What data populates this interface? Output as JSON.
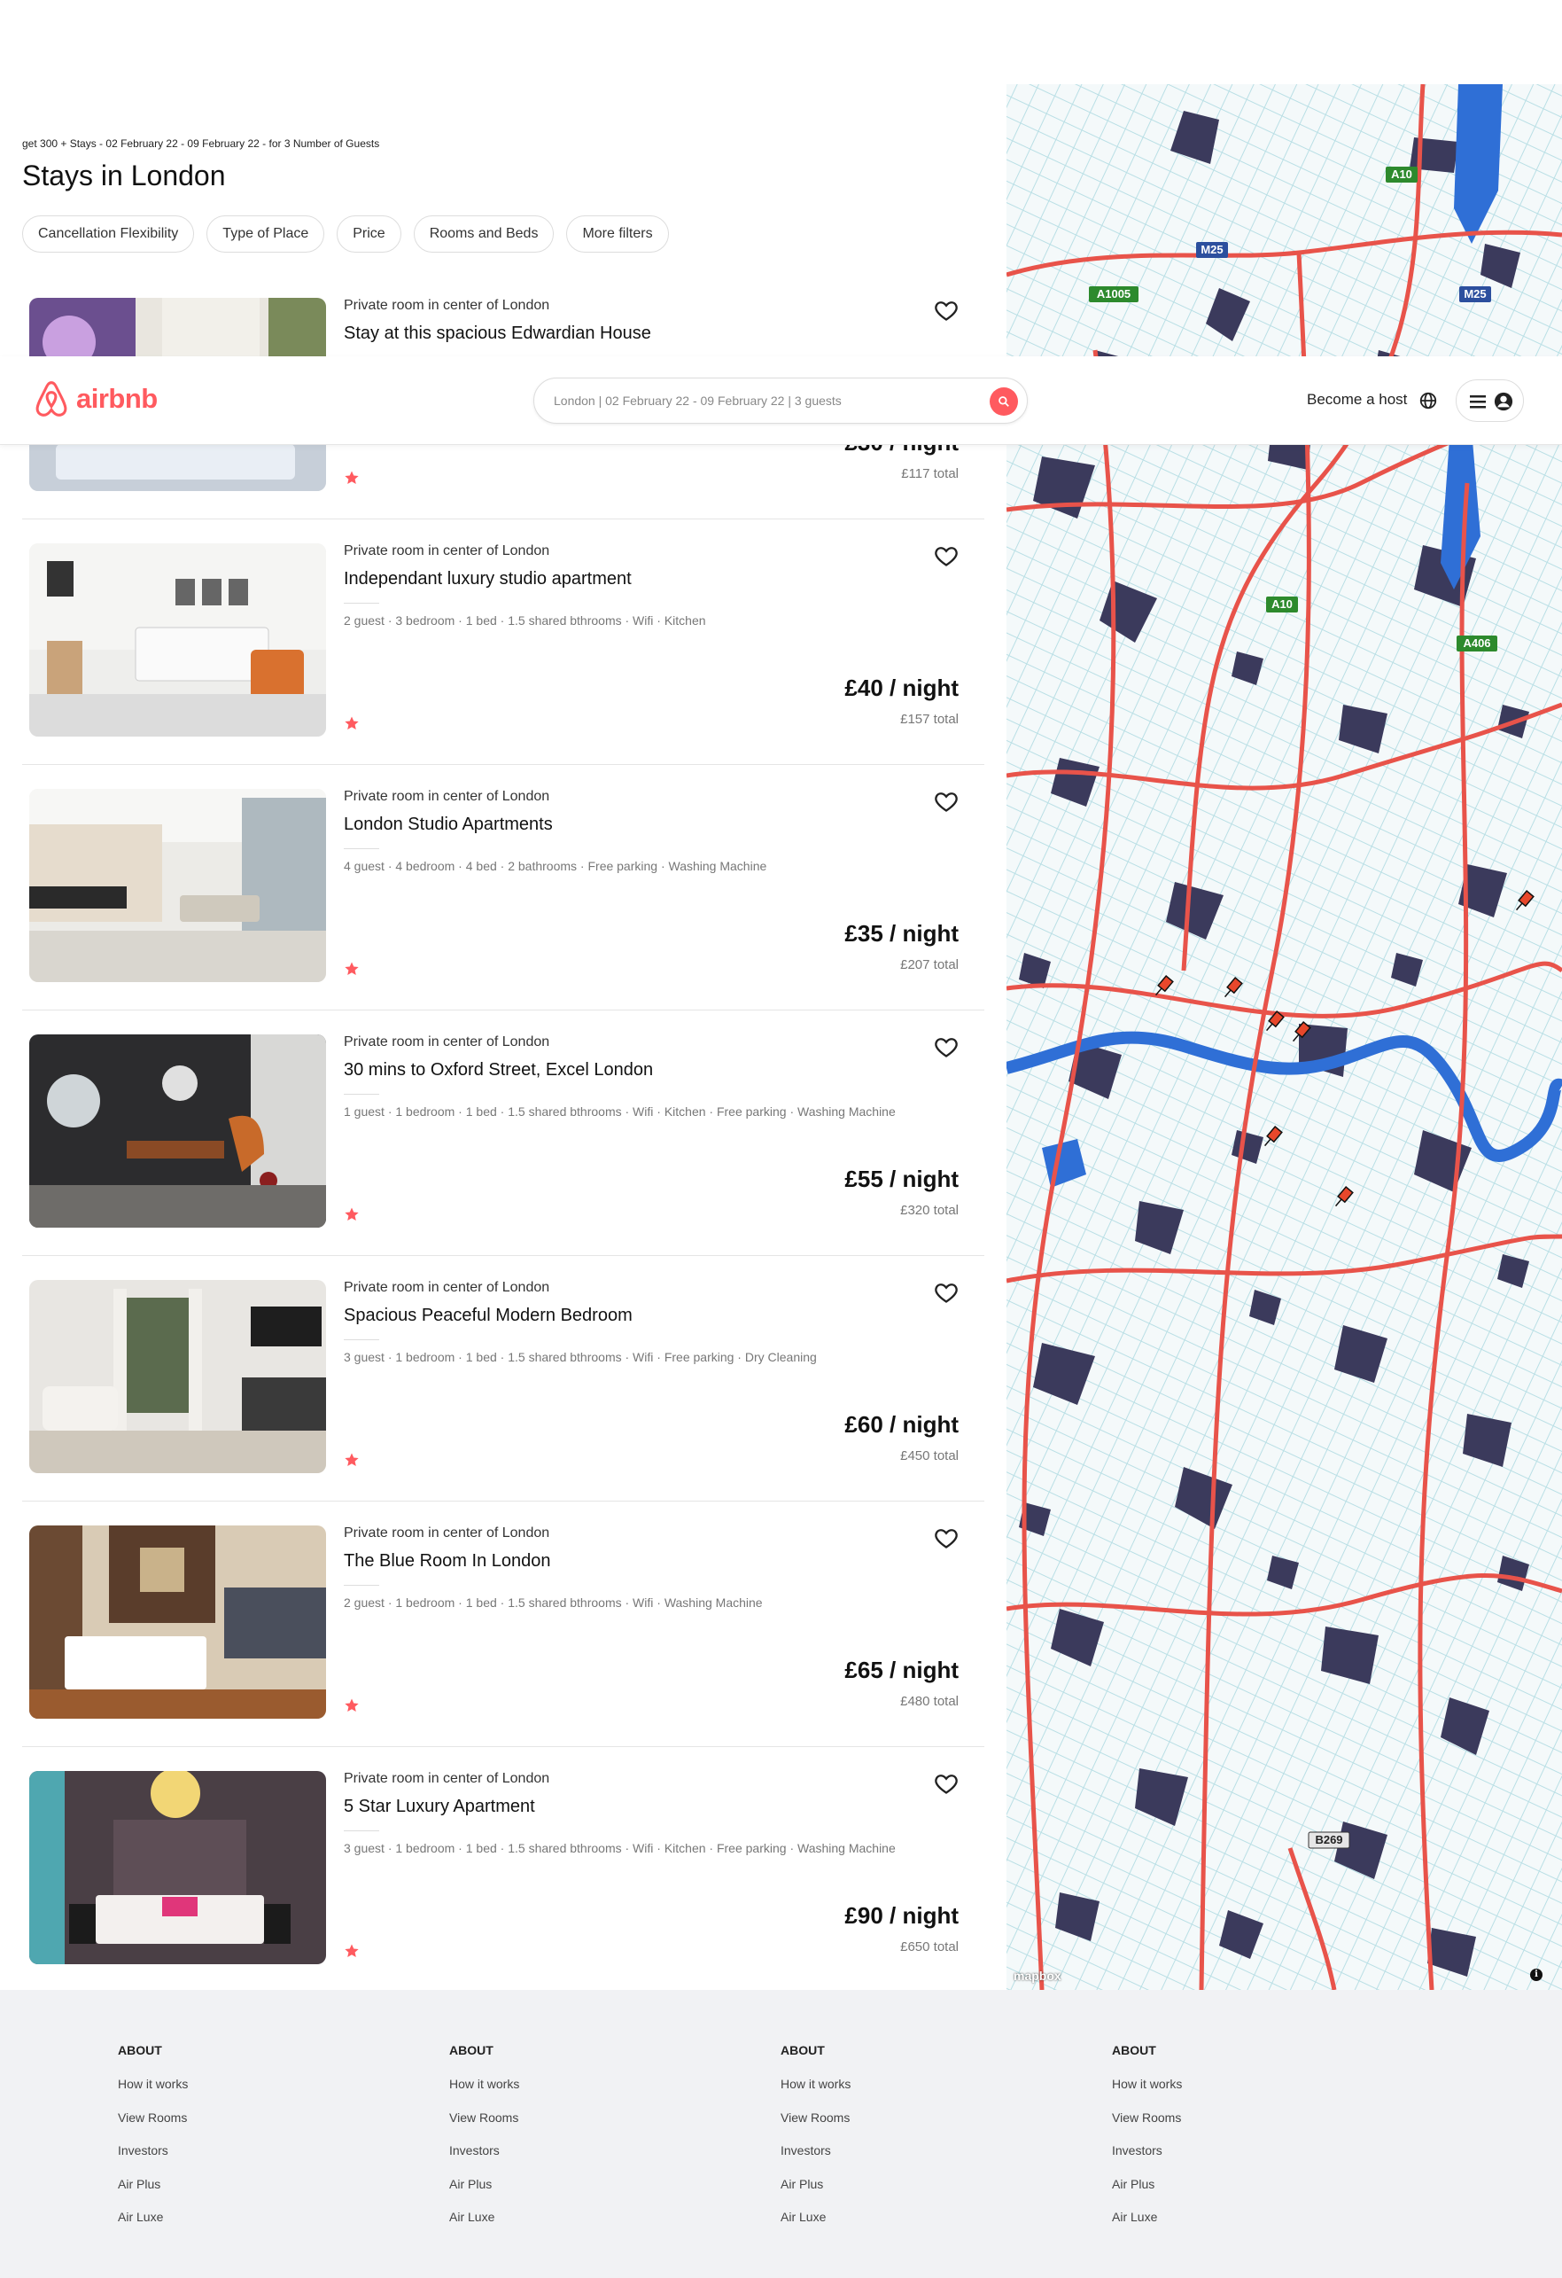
{
  "search": {
    "summary": "get 300 + Stays - 02 February 22 - 09 February 22 - for 3 Number of Guests",
    "title": "Stays in London",
    "filters": [
      "Cancellation Flexibility",
      "Type of Place",
      "Price",
      "Rooms and Beds",
      "More filters"
    ]
  },
  "header": {
    "brand": "airbnb",
    "search_text": "London | 02 February 22 - 09 February 22 | 3 guests",
    "host_label": "Become a host"
  },
  "listings": [
    {
      "subtitle": "Private room in center of London",
      "title": "Stay at this spacious Edwardian House",
      "amenities": "",
      "price": "£30 / night",
      "total": "£117 total"
    },
    {
      "subtitle": "Private room in center of London",
      "title": "Independant luxury studio apartment",
      "amenities": "2 guest · 3 bedroom · 1 bed · 1.5 shared bthrooms · Wifi · Kitchen",
      "price": "£40 / night",
      "total": "£157 total"
    },
    {
      "subtitle": "Private room in center of London",
      "title": "London Studio Apartments",
      "amenities": "4 guest · 4 bedroom · 4 bed · 2 bathrooms · Free parking · Washing Machine",
      "price": "£35 / night",
      "total": "£207 total"
    },
    {
      "subtitle": "Private room in center of London",
      "title": "30 mins to Oxford Street, Excel London",
      "amenities": "1 guest · 1 bedroom · 1 bed · 1.5 shared bthrooms · Wifi · Kitchen · Free parking · Washing Machine",
      "price": "£55 / night",
      "total": "£320 total"
    },
    {
      "subtitle": "Private room in center of London",
      "title": "Spacious Peaceful Modern Bedroom",
      "amenities": "3 guest · 1 bedroom · 1 bed · 1.5 shared bthrooms · Wifi · Free parking · Dry Cleaning",
      "price": "£60 / night",
      "total": "£450 total"
    },
    {
      "subtitle": "Private room in center of London",
      "title": "The Blue Room In London",
      "amenities": "2 guest · 1 bedroom · 1 bed · 1.5 shared bthrooms · Wifi · Washing Machine",
      "price": "£65 / night",
      "total": "£480 total"
    },
    {
      "subtitle": "Private room in center of London",
      "title": "5 Star Luxury Apartment",
      "amenities": "3 guest · 1 bedroom · 1 bed · 1.5 shared bthrooms · Wifi · Kitchen · Free parking · Washing Machine",
      "price": "£90 / night",
      "total": "£650 total"
    }
  ],
  "map": {
    "road_labels": [
      "A10",
      "M25",
      "A1005",
      "M25",
      "A10",
      "A406",
      "B269"
    ],
    "attribution": "mapbox"
  },
  "footer": {
    "columns": [
      {
        "heading": "ABOUT",
        "links": [
          "How it works",
          "View Rooms",
          "Investors",
          "Air Plus",
          "Air Luxe"
        ]
      },
      {
        "heading": "ABOUT",
        "links": [
          "How it works",
          "View Rooms",
          "Investors",
          "Air Plus",
          "Air Luxe"
        ]
      },
      {
        "heading": "ABOUT",
        "links": [
          "How it works",
          "View Rooms",
          "Investors",
          "Air Plus",
          "Air Luxe"
        ]
      },
      {
        "heading": "ABOUT",
        "links": [
          "How it works",
          "View Rooms",
          "Investors",
          "Air Plus",
          "Air Luxe"
        ]
      }
    ]
  },
  "colors": {
    "brand": "#ff5a5f",
    "road": "#e8534a",
    "water": "#2f6fd6",
    "park": "#3b3a5c"
  },
  "icons": [
    "airbnb-logo-icon",
    "search-icon",
    "globe-icon",
    "menu-icon",
    "user-icon",
    "heart-icon",
    "star-icon",
    "map-pin-icon",
    "info-icon"
  ]
}
